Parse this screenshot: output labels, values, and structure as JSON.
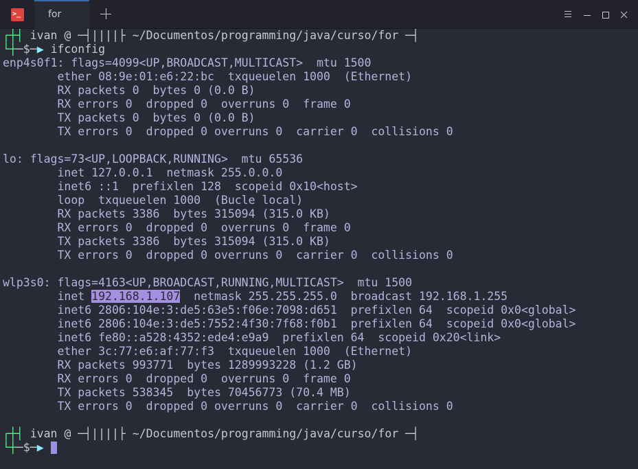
{
  "window": {
    "app_icon_text": ">_",
    "tab_label": "for",
    "accent_color": "#3b6ea8"
  },
  "colors": {
    "background": "#282a36",
    "output_text": "#b4b4dc",
    "prompt_green": "#50fa7b",
    "arrow_cyan": "#8be9fd",
    "selection": "#a58fe0"
  },
  "prompt": {
    "top_glyph": "┌┼┤",
    "user": "ivan",
    "at": "@",
    "mid_glyph": "─┤||||├",
    "path": "~/Documentos/programming/java/curso/for",
    "end_glyph": "─┤",
    "bottom_glyph": "└┼",
    "dollar": "─$─",
    "arrow": "▶"
  },
  "command": "ifconfig",
  "output": {
    "l01": "enp4s0f1: flags=4099<UP,BROADCAST,MULTICAST>  mtu 1500",
    "l02": "        ether 08:9e:01:e6:22:bc  txqueuelen 1000  (Ethernet)",
    "l03": "        RX packets 0  bytes 0 (0.0 B)",
    "l04": "        RX errors 0  dropped 0  overruns 0  frame 0",
    "l05": "        TX packets 0  bytes 0 (0.0 B)",
    "l06": "        TX errors 0  dropped 0 overruns 0  carrier 0  collisions 0",
    "l08": "lo: flags=73<UP,LOOPBACK,RUNNING>  mtu 65536",
    "l09": "        inet 127.0.0.1  netmask 255.0.0.0",
    "l10": "        inet6 ::1  prefixlen 128  scopeid 0x10<host>",
    "l11": "        loop  txqueuelen 1000  (Bucle local)",
    "l12": "        RX packets 3386  bytes 315094 (315.0 KB)",
    "l13": "        RX errors 0  dropped 0  overruns 0  frame 0",
    "l14": "        TX packets 3386  bytes 315094 (315.0 KB)",
    "l15": "        TX errors 0  dropped 0 overruns 0  carrier 0  collisions 0",
    "l17": "wlp3s0: flags=4163<UP,BROADCAST,RUNNING,MULTICAST>  mtu 1500",
    "l18_prefix": "        inet ",
    "l18_ip": "192.168.1.107",
    "l18_suffix": "  netmask 255.255.255.0  broadcast 192.168.1.255",
    "l19": "        inet6 2806:104e:3:de5:63e5:f06e:7098:d651  prefixlen 64  scopeid 0x0<global>",
    "l20": "        inet6 2806:104e:3:de5:7552:4f30:7f68:f0b1  prefixlen 64  scopeid 0x0<global>",
    "l21": "        inet6 fe80::a528:4352:ede4:e9a9  prefixlen 64  scopeid 0x20<link>",
    "l22": "        ether 3c:77:e6:af:77:f3  txqueuelen 1000  (Ethernet)",
    "l23": "        RX packets 993771  bytes 1289993228 (1.2 GB)",
    "l24": "        RX errors 0  dropped 0  overruns 0  frame 0",
    "l25": "        TX packets 538345  bytes 70456773 (70.4 MB)",
    "l26": "        TX errors 0  dropped 0 overruns 0  carrier 0  collisions 0"
  }
}
